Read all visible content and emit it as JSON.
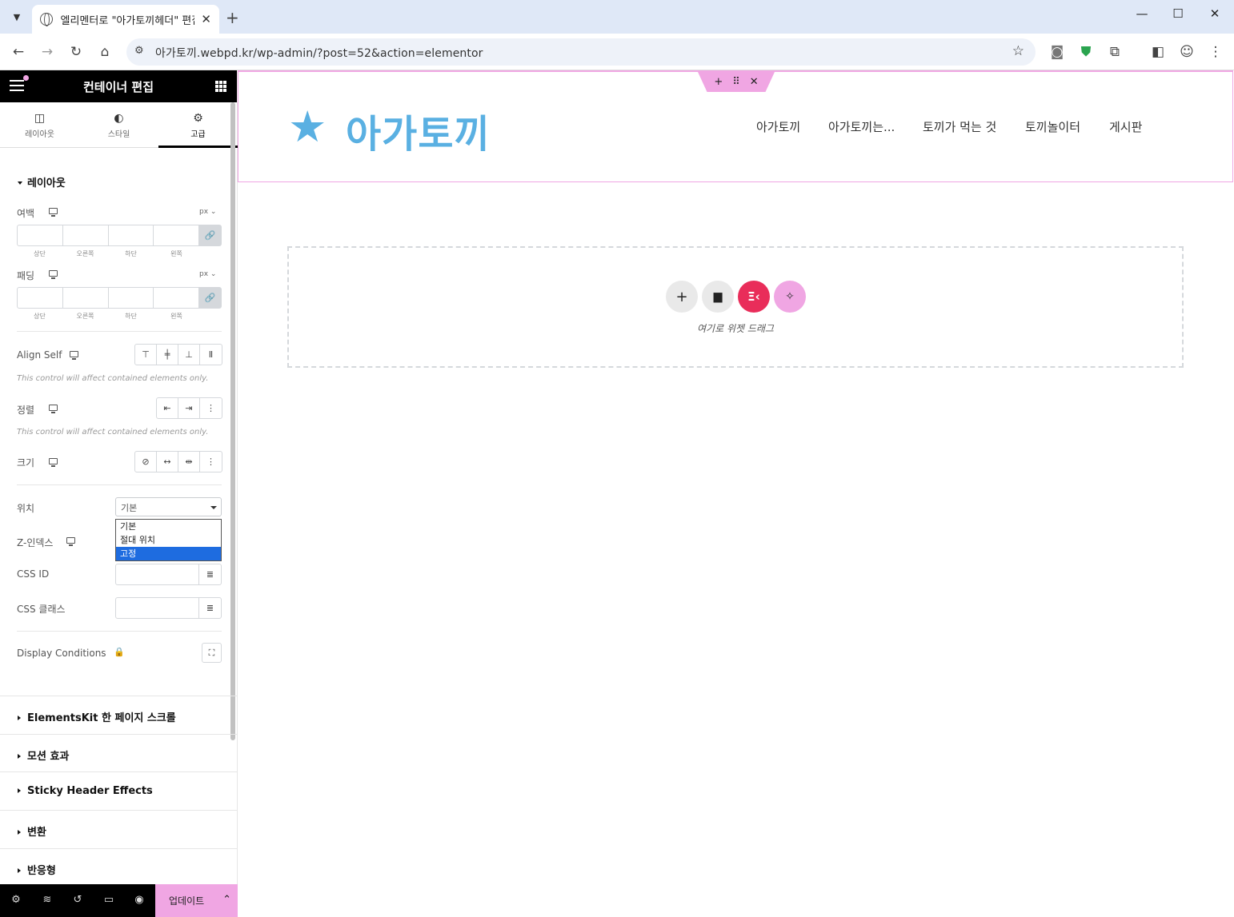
{
  "browser": {
    "tab_title": "엘리멘터로 \"아가토끼헤더\" 편집",
    "url": "아가토끼.webpd.kr/wp-admin/?post=52&action=elementor",
    "icons": [
      "chevron-down-icon",
      "globe-icon",
      "close-icon",
      "plus-icon",
      "minimize-icon",
      "maximize-icon",
      "back-icon",
      "forward-icon",
      "reload-icon",
      "home-icon",
      "site-info-icon",
      "bookmark-star-icon",
      "camera-icon",
      "shield-icon",
      "extensions-icon",
      "side-panel-icon",
      "profile-icon",
      "more-icon"
    ]
  },
  "panel": {
    "title": "컨테이너 편집",
    "tabs": [
      {
        "label": "레이아웃",
        "icon": "layout-icon"
      },
      {
        "label": "스타일",
        "icon": "contrast-icon"
      },
      {
        "label": "고급",
        "icon": "gear-icon"
      }
    ],
    "section_title": "레이아웃",
    "margin": {
      "label": "여백",
      "unit": "px",
      "sides": [
        "상단",
        "오른쪽",
        "하단",
        "왼쪽"
      ]
    },
    "padding": {
      "label": "패딩",
      "unit": "px",
      "sides": [
        "상단",
        "오른쪽",
        "하단",
        "왼쪽"
      ]
    },
    "align_self": {
      "label": "Align Self",
      "hint": "This control will affect contained elements only."
    },
    "order": {
      "label": "정렬",
      "hint": "This control will affect contained elements only."
    },
    "size": {
      "label": "크기"
    },
    "position": {
      "label": "위치",
      "selected": "기본",
      "options": [
        "기본",
        "절대 위치",
        "고정"
      ],
      "highlighted": "고정"
    },
    "z_index": {
      "label": "Z-인덱스"
    },
    "css_id": {
      "label": "CSS ID"
    },
    "css_classes": {
      "label": "CSS 클래스"
    },
    "display_conditions": {
      "label": "Display Conditions"
    },
    "accordions": [
      "ElementsKit 한 페이지 스크롤",
      "모션 효과",
      "Sticky Header Effects",
      "변환",
      "반응형"
    ],
    "footer": {
      "update_label": "업데이트"
    }
  },
  "canvas": {
    "logo_text": "아가토끼",
    "nav": [
      "아가토끼",
      "아가토끼는...",
      "토끼가 먹는 것",
      "토끼놀이터",
      "게시판"
    ],
    "dropzone_text": "여기로 위젯 드래그"
  },
  "colors": {
    "accent_pink": "#f0a6e3",
    "logo_blue": "#5ab0e2",
    "elementor_red": "#e92d5a",
    "selected_blue": "#1e6ce0"
  }
}
